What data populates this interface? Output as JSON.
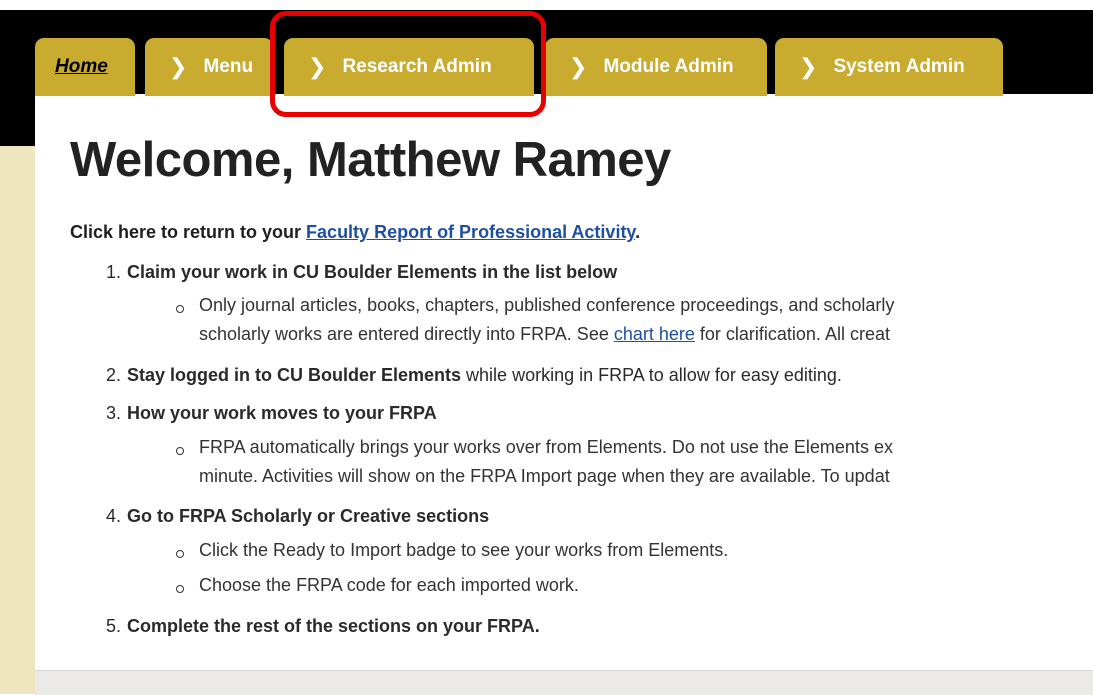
{
  "tabs": {
    "home": "Home",
    "menu": "Menu",
    "research": "Research Admin",
    "module": "Module Admin",
    "system": "System Admin",
    "chevron": "❯"
  },
  "page": {
    "title": "Welcome, Matthew Ramey",
    "return_prefix": "Click here to return to your ",
    "return_link": "Faculty Report of Professional Activity",
    "return_suffix": "."
  },
  "steps": [
    {
      "number": "1.",
      "bold": "Claim your work in CU Boulder Elements in the list below",
      "rest": "",
      "bullets": [
        {
          "text_a": "Only journal articles, books, chapters, published conference proceedings, and scholarly"
        },
        {
          "text_a": "scholarly works are entered directly into FRPA. See ",
          "link": "chart here",
          "text_b": " for clarification. All creat"
        }
      ]
    },
    {
      "number": "2.",
      "bold": "Stay logged in to CU Boulder Elements",
      "rest": " while working in FRPA to allow for easy editing.",
      "bullets": []
    },
    {
      "number": "3.",
      "bold": "How your work moves to your FRPA",
      "rest": "",
      "bullets": [
        {
          "text_a": "FRPA automatically brings your works over from Elements. Do not use the Elements ex"
        },
        {
          "text_a": "minute. Activities will show on the FRPA Import page when they are available. To updat"
        }
      ]
    },
    {
      "number": "4.",
      "bold": "Go to FRPA Scholarly or Creative sections",
      "rest": "",
      "bullets": [
        {
          "text_a": "Click the Ready to Import badge to see your works from Elements."
        },
        {
          "text_a": "Choose the FRPA code for each imported work."
        }
      ]
    },
    {
      "number": "5.",
      "bold": "Complete the rest of the sections on your FRPA.",
      "rest": "",
      "bullets": []
    }
  ],
  "colors": {
    "tab_gold": "#c9ac2f",
    "highlight_red": "#e60000",
    "link_blue": "#1f4fa0",
    "cream": "#efe6bd"
  }
}
